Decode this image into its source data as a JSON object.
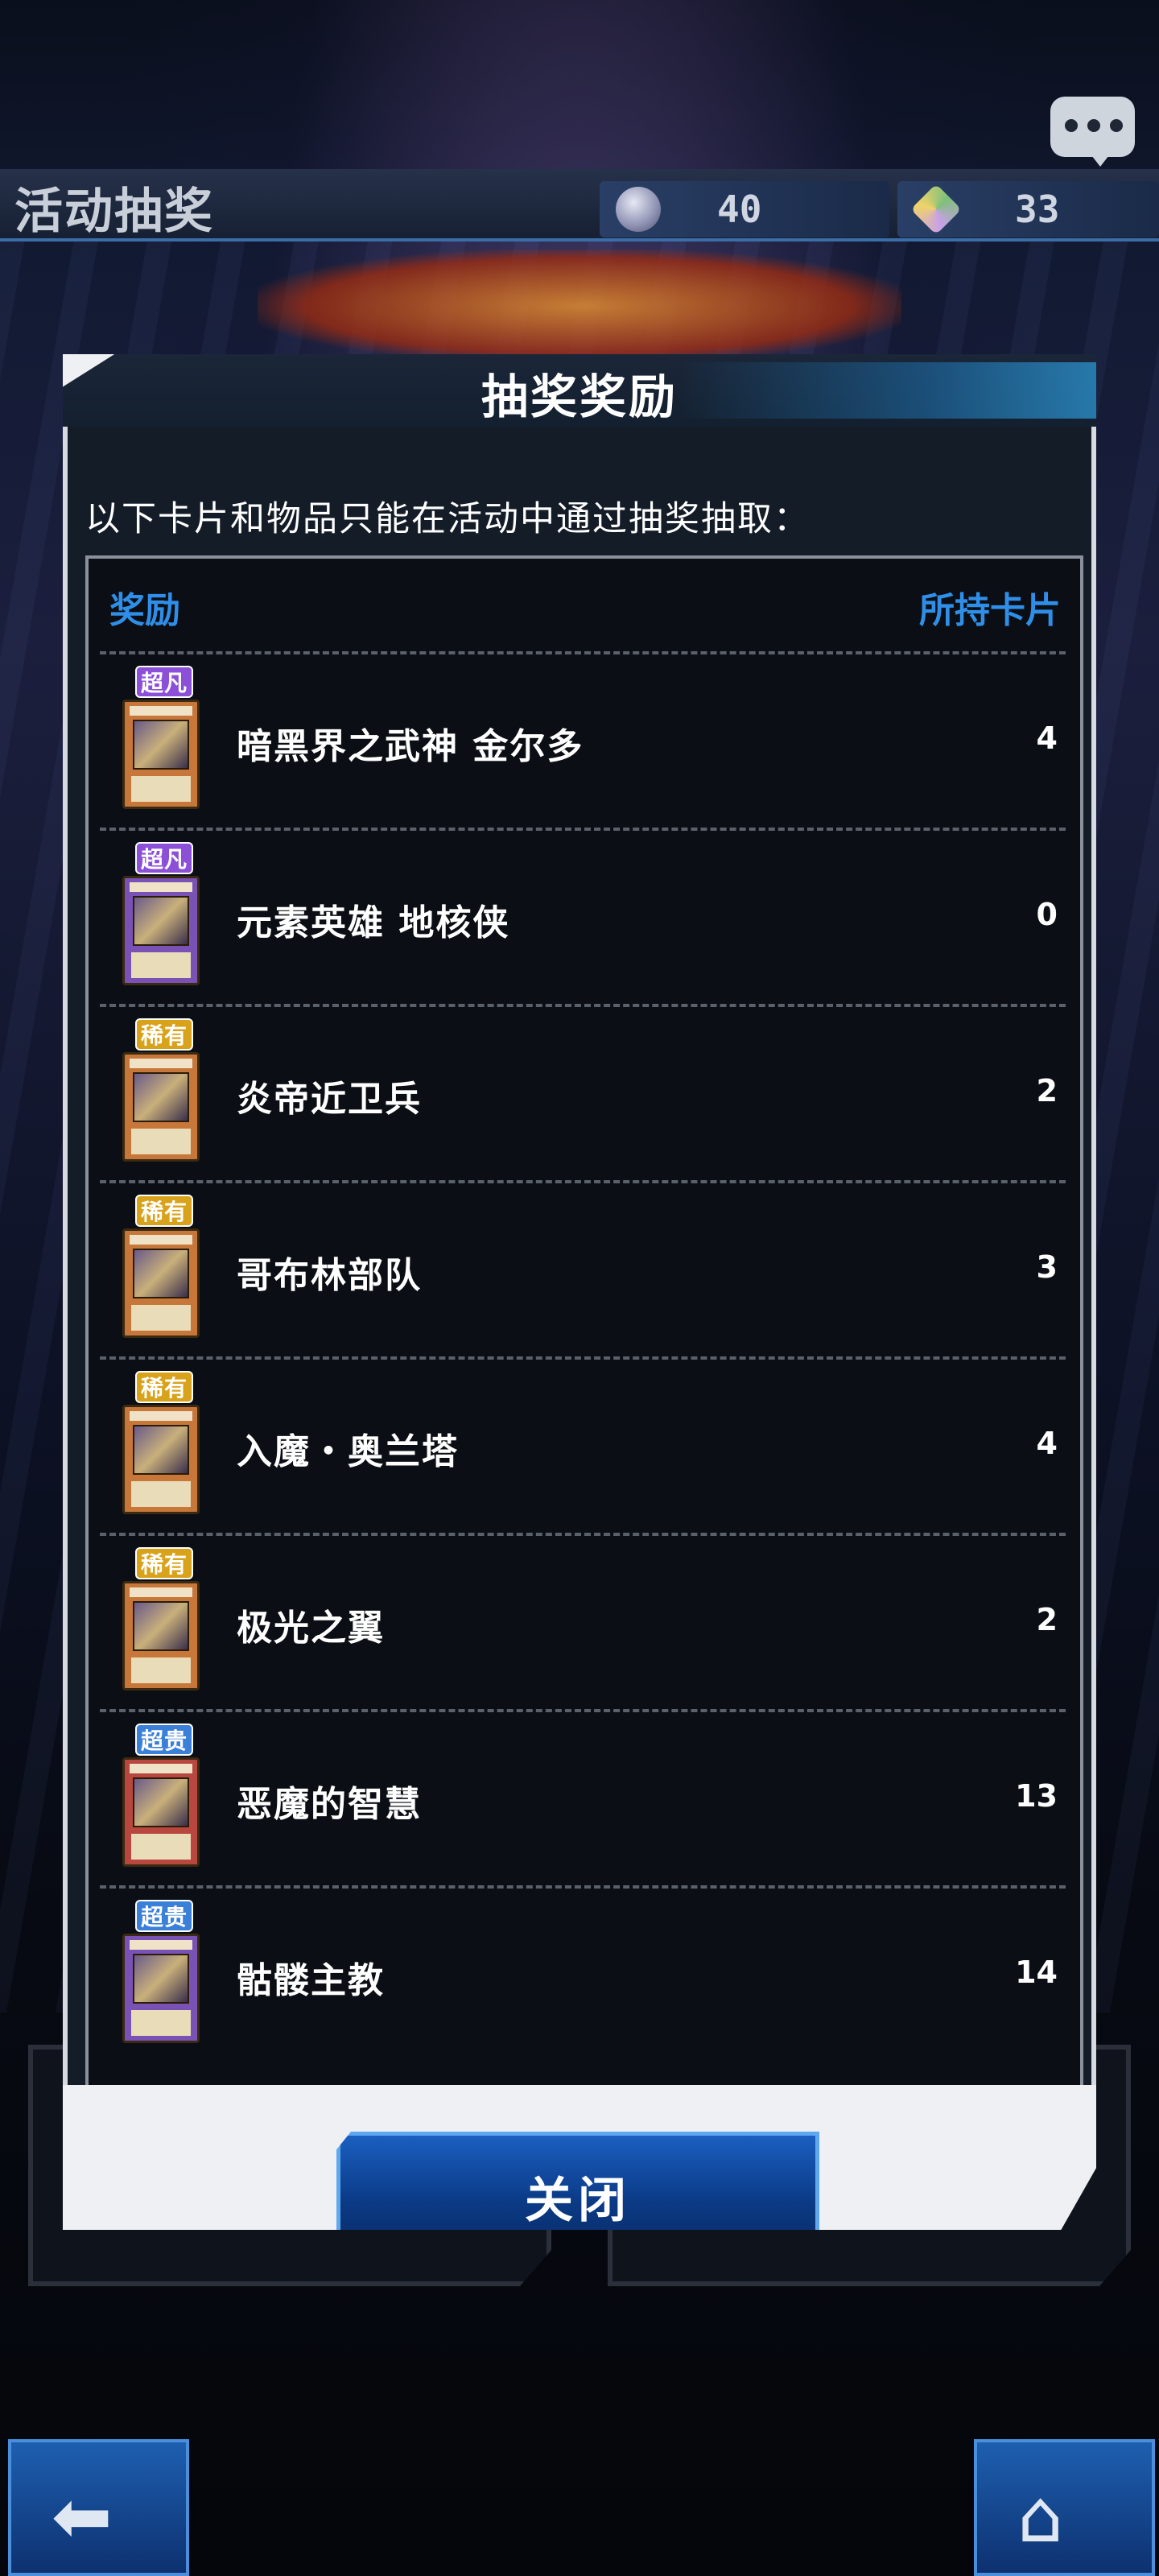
{
  "screen": {
    "title": "活动抽奖",
    "currencies": [
      {
        "icon": "orb-currency-icon",
        "amount": "40",
        "color": "#8c8fb0"
      },
      {
        "icon": "gem-currency-icon",
        "amount": "33",
        "color": "#7ec07a"
      }
    ]
  },
  "dialog": {
    "title": "抽奖奖励",
    "notice": "以下卡片和物品只能在活动中通过抽奖抽取：",
    "columns": {
      "reward": "奖励",
      "owned": "所持卡片"
    },
    "rows": [
      {
        "rarity": "超凡",
        "rarity_color": "#8b4fd8",
        "card_color": "#c8773b",
        "name": "暗黑界之武神 金尔多",
        "owned": "4"
      },
      {
        "rarity": "超凡",
        "rarity_color": "#8b4fd8",
        "card_color": "#7a52b5",
        "name": "元素英雄 地核侠",
        "owned": "0"
      },
      {
        "rarity": "稀有",
        "rarity_color": "#d8a21b",
        "card_color": "#c8773b",
        "name": "炎帝近卫兵",
        "owned": "2"
      },
      {
        "rarity": "稀有",
        "rarity_color": "#d8a21b",
        "card_color": "#c8773b",
        "name": "哥布林部队",
        "owned": "3"
      },
      {
        "rarity": "稀有",
        "rarity_color": "#d8a21b",
        "card_color": "#c8773b",
        "name": "入魔・奥兰塔",
        "owned": "4"
      },
      {
        "rarity": "稀有",
        "rarity_color": "#d8a21b",
        "card_color": "#c8773b",
        "name": "极光之翼",
        "owned": "2"
      },
      {
        "rarity": "超贵",
        "rarity_color": "#3a7fd8",
        "card_color": "#b8473f",
        "name": "恶魔的智慧",
        "owned": "13"
      },
      {
        "rarity": "超贵",
        "rarity_color": "#3a7fd8",
        "card_color": "#7a52b5",
        "name": "骷髅主教",
        "owned": "14"
      }
    ],
    "close_label": "关闭"
  },
  "colors": {
    "accent_blue": "#2f8fe8",
    "button_blue": "#0b3a86"
  }
}
